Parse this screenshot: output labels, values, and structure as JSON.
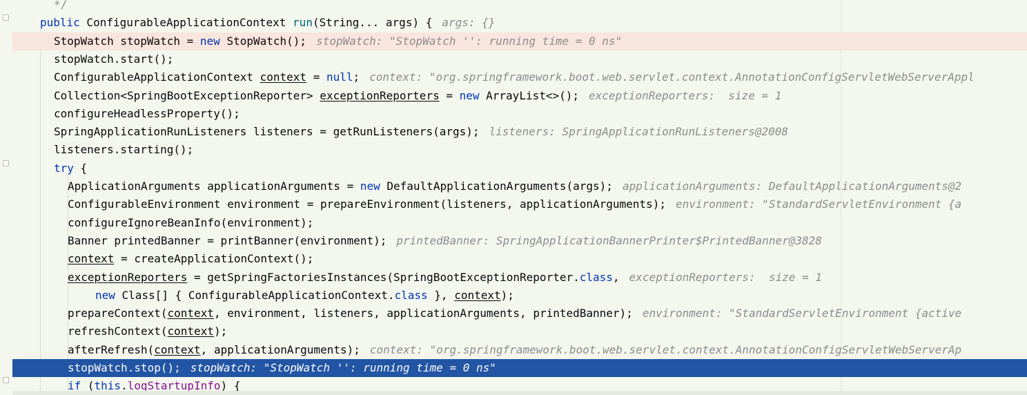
{
  "editor": {
    "lines": [
      {
        "indent": "  ",
        "code": "*/",
        "hint": ""
      },
      {
        "indent": "",
        "code": "public ConfigurableApplicationContext run(String... args) {",
        "hint": "args: {}"
      },
      {
        "indent": "  ",
        "code": "StopWatch stopWatch = new StopWatch();",
        "hint": "stopWatch: \"StopWatch '': running time = 0 ns\""
      },
      {
        "indent": "  ",
        "code": "stopWatch.start();",
        "hint": ""
      },
      {
        "indent": "  ",
        "code": "ConfigurableApplicationContext context = null;",
        "hint": "context: \"org.springframework.boot.web.servlet.context.AnnotationConfigServletWebServerAppl"
      },
      {
        "indent": "  ",
        "code": "Collection<SpringBootExceptionReporter> exceptionReporters = new ArrayList<>();",
        "hint": "exceptionReporters:  size = 1"
      },
      {
        "indent": "  ",
        "code": "configureHeadlessProperty();",
        "hint": ""
      },
      {
        "indent": "  ",
        "code": "SpringApplicationRunListeners listeners = getRunListeners(args);",
        "hint": "listeners: SpringApplicationRunListeners@2008"
      },
      {
        "indent": "  ",
        "code": "listeners.starting();",
        "hint": ""
      },
      {
        "indent": "  ",
        "code": "try {",
        "hint": ""
      },
      {
        "indent": "    ",
        "code": "ApplicationArguments applicationArguments = new DefaultApplicationArguments(args);",
        "hint": "applicationArguments: DefaultApplicationArguments@2"
      },
      {
        "indent": "    ",
        "code": "ConfigurableEnvironment environment = prepareEnvironment(listeners, applicationArguments);",
        "hint": "environment: \"StandardServletEnvironment {a"
      },
      {
        "indent": "    ",
        "code": "configureIgnoreBeanInfo(environment);",
        "hint": ""
      },
      {
        "indent": "    ",
        "code": "Banner printedBanner = printBanner(environment);",
        "hint": "printedBanner: SpringApplicationBannerPrinter$PrintedBanner@3828"
      },
      {
        "indent": "    ",
        "code": "context = createApplicationContext();",
        "hint": ""
      },
      {
        "indent": "    ",
        "code": "exceptionReporters = getSpringFactoriesInstances(SpringBootExceptionReporter.class,",
        "hint": "exceptionReporters:  size = 1"
      },
      {
        "indent": "        ",
        "code": "new Class[] { ConfigurableApplicationContext.class }, context);",
        "hint": ""
      },
      {
        "indent": "    ",
        "code": "prepareContext(context, environment, listeners, applicationArguments, printedBanner);",
        "hint": "environment: \"StandardServletEnvironment {active"
      },
      {
        "indent": "    ",
        "code": "refreshContext(context);",
        "hint": ""
      },
      {
        "indent": "    ",
        "code": "afterRefresh(context, applicationArguments);",
        "hint": "context: \"org.springframework.boot.web.servlet.context.AnnotationConfigServletWebServerAp"
      },
      {
        "indent": "    ",
        "code": "stopWatch.stop();",
        "hint": "stopWatch: \"StopWatch '': running time = 0 ns\""
      },
      {
        "indent": "    ",
        "code": "if (this.logStartupInfo) {",
        "hint": ""
      }
    ]
  },
  "colors": {
    "background": "#f3f7ee",
    "keyword": "#0033b3",
    "hint": "#8c8c8c",
    "execution_line": "#f8e5de",
    "current_line": "#2255a4"
  }
}
